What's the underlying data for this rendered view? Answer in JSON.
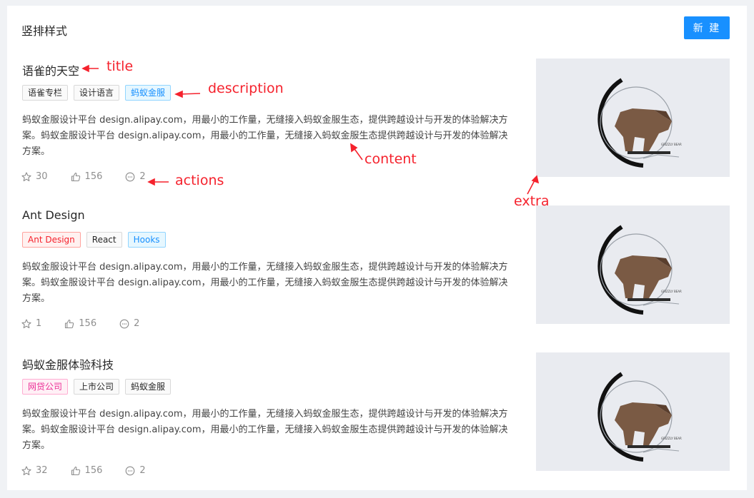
{
  "header": {
    "title": "竖排样式",
    "new_button": "新 建"
  },
  "items": [
    {
      "title": "语雀的天空",
      "tags": [
        {
          "label": "语雀专栏",
          "color": "default"
        },
        {
          "label": "设计语言",
          "color": "default"
        },
        {
          "label": "蚂蚁金服",
          "color": "blue"
        }
      ],
      "content": "蚂蚁金服设计平台 design.alipay.com，用最小的工作量，无缝接入蚂蚁金服生态，提供跨越设计与开发的体验解决方案。蚂蚁金服设计平台 design.alipay.com，用最小的工作量，无缝接入蚂蚁金服生态提供跨越设计与开发的体验解决方案。",
      "stars": "30",
      "likes": "156",
      "comments": "2"
    },
    {
      "title": "Ant Design",
      "tags": [
        {
          "label": "Ant Design",
          "color": "red"
        },
        {
          "label": "React",
          "color": "default"
        },
        {
          "label": "Hooks",
          "color": "blue"
        }
      ],
      "content": "蚂蚁金服设计平台 design.alipay.com，用最小的工作量，无缝接入蚂蚁金服生态，提供跨越设计与开发的体验解决方案。蚂蚁金服设计平台 design.alipay.com，用最小的工作量，无缝接入蚂蚁金服生态提供跨越设计与开发的体验解决方案。",
      "stars": "1",
      "likes": "156",
      "comments": "2"
    },
    {
      "title": "蚂蚁金服体验科技",
      "tags": [
        {
          "label": "网贷公司",
          "color": "magenta"
        },
        {
          "label": "上市公司",
          "color": "default"
        },
        {
          "label": "蚂蚁金服",
          "color": "default"
        }
      ],
      "content": "蚂蚁金服设计平台 design.alipay.com，用最小的工作量，无缝接入蚂蚁金服生态，提供跨越设计与开发的体验解决方案。蚂蚁金服设计平台 design.alipay.com，用最小的工作量，无缝接入蚂蚁金服生态提供跨越设计与开发的体验解决方案。",
      "stars": "32",
      "likes": "156",
      "comments": "2"
    }
  ],
  "extra_image": {
    "logo_text": "GRIZZLY BEAR"
  },
  "annotations": {
    "title": "title",
    "description": "description",
    "content": "content",
    "actions": "actions",
    "extra": "extra"
  },
  "colors": {
    "primary": "#1890ff",
    "annotation": "#f5222d"
  }
}
